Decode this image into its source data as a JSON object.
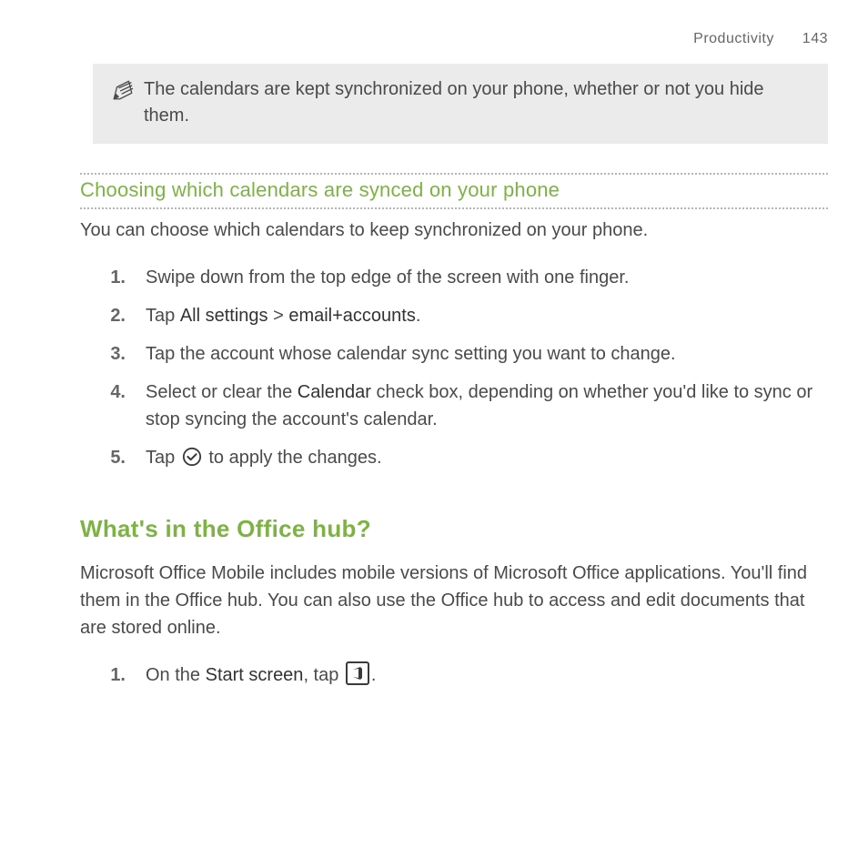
{
  "header": {
    "section": "Productivity",
    "page_number": "143"
  },
  "note": {
    "text": "The calendars are kept synchronized on your phone, whether or not you hide them."
  },
  "section1": {
    "heading": "Choosing which calendars are synced on your phone",
    "intro": "You can choose which calendars to keep synchronized on your phone.",
    "steps": {
      "n1": "1.",
      "s1": "Swipe down from the top edge of the screen with one finger.",
      "n2": "2.",
      "s2a": "Tap ",
      "s2b": "All settings",
      "s2c": " > ",
      "s2d": "email+accounts",
      "s2e": ".",
      "n3": "3.",
      "s3": "Tap the account whose calendar sync setting you want to change.",
      "n4": "4.",
      "s4a": "Select or clear the ",
      "s4b": "Calendar",
      "s4c": " check box, depending on whether you'd like to sync or stop syncing the account's calendar.",
      "n5": "5.",
      "s5a": "Tap ",
      "s5b": " to apply the changes."
    }
  },
  "section2": {
    "heading": "What's in the Office hub?",
    "intro": "Microsoft Office Mobile includes mobile versions of Microsoft Office applications. You'll find them in the Office hub. You can also use the Office hub to access and edit documents that are stored online.",
    "steps": {
      "n1": "1.",
      "s1a": "On the ",
      "s1b": "Start screen",
      "s1c": ", tap ",
      "s1d": "."
    }
  }
}
